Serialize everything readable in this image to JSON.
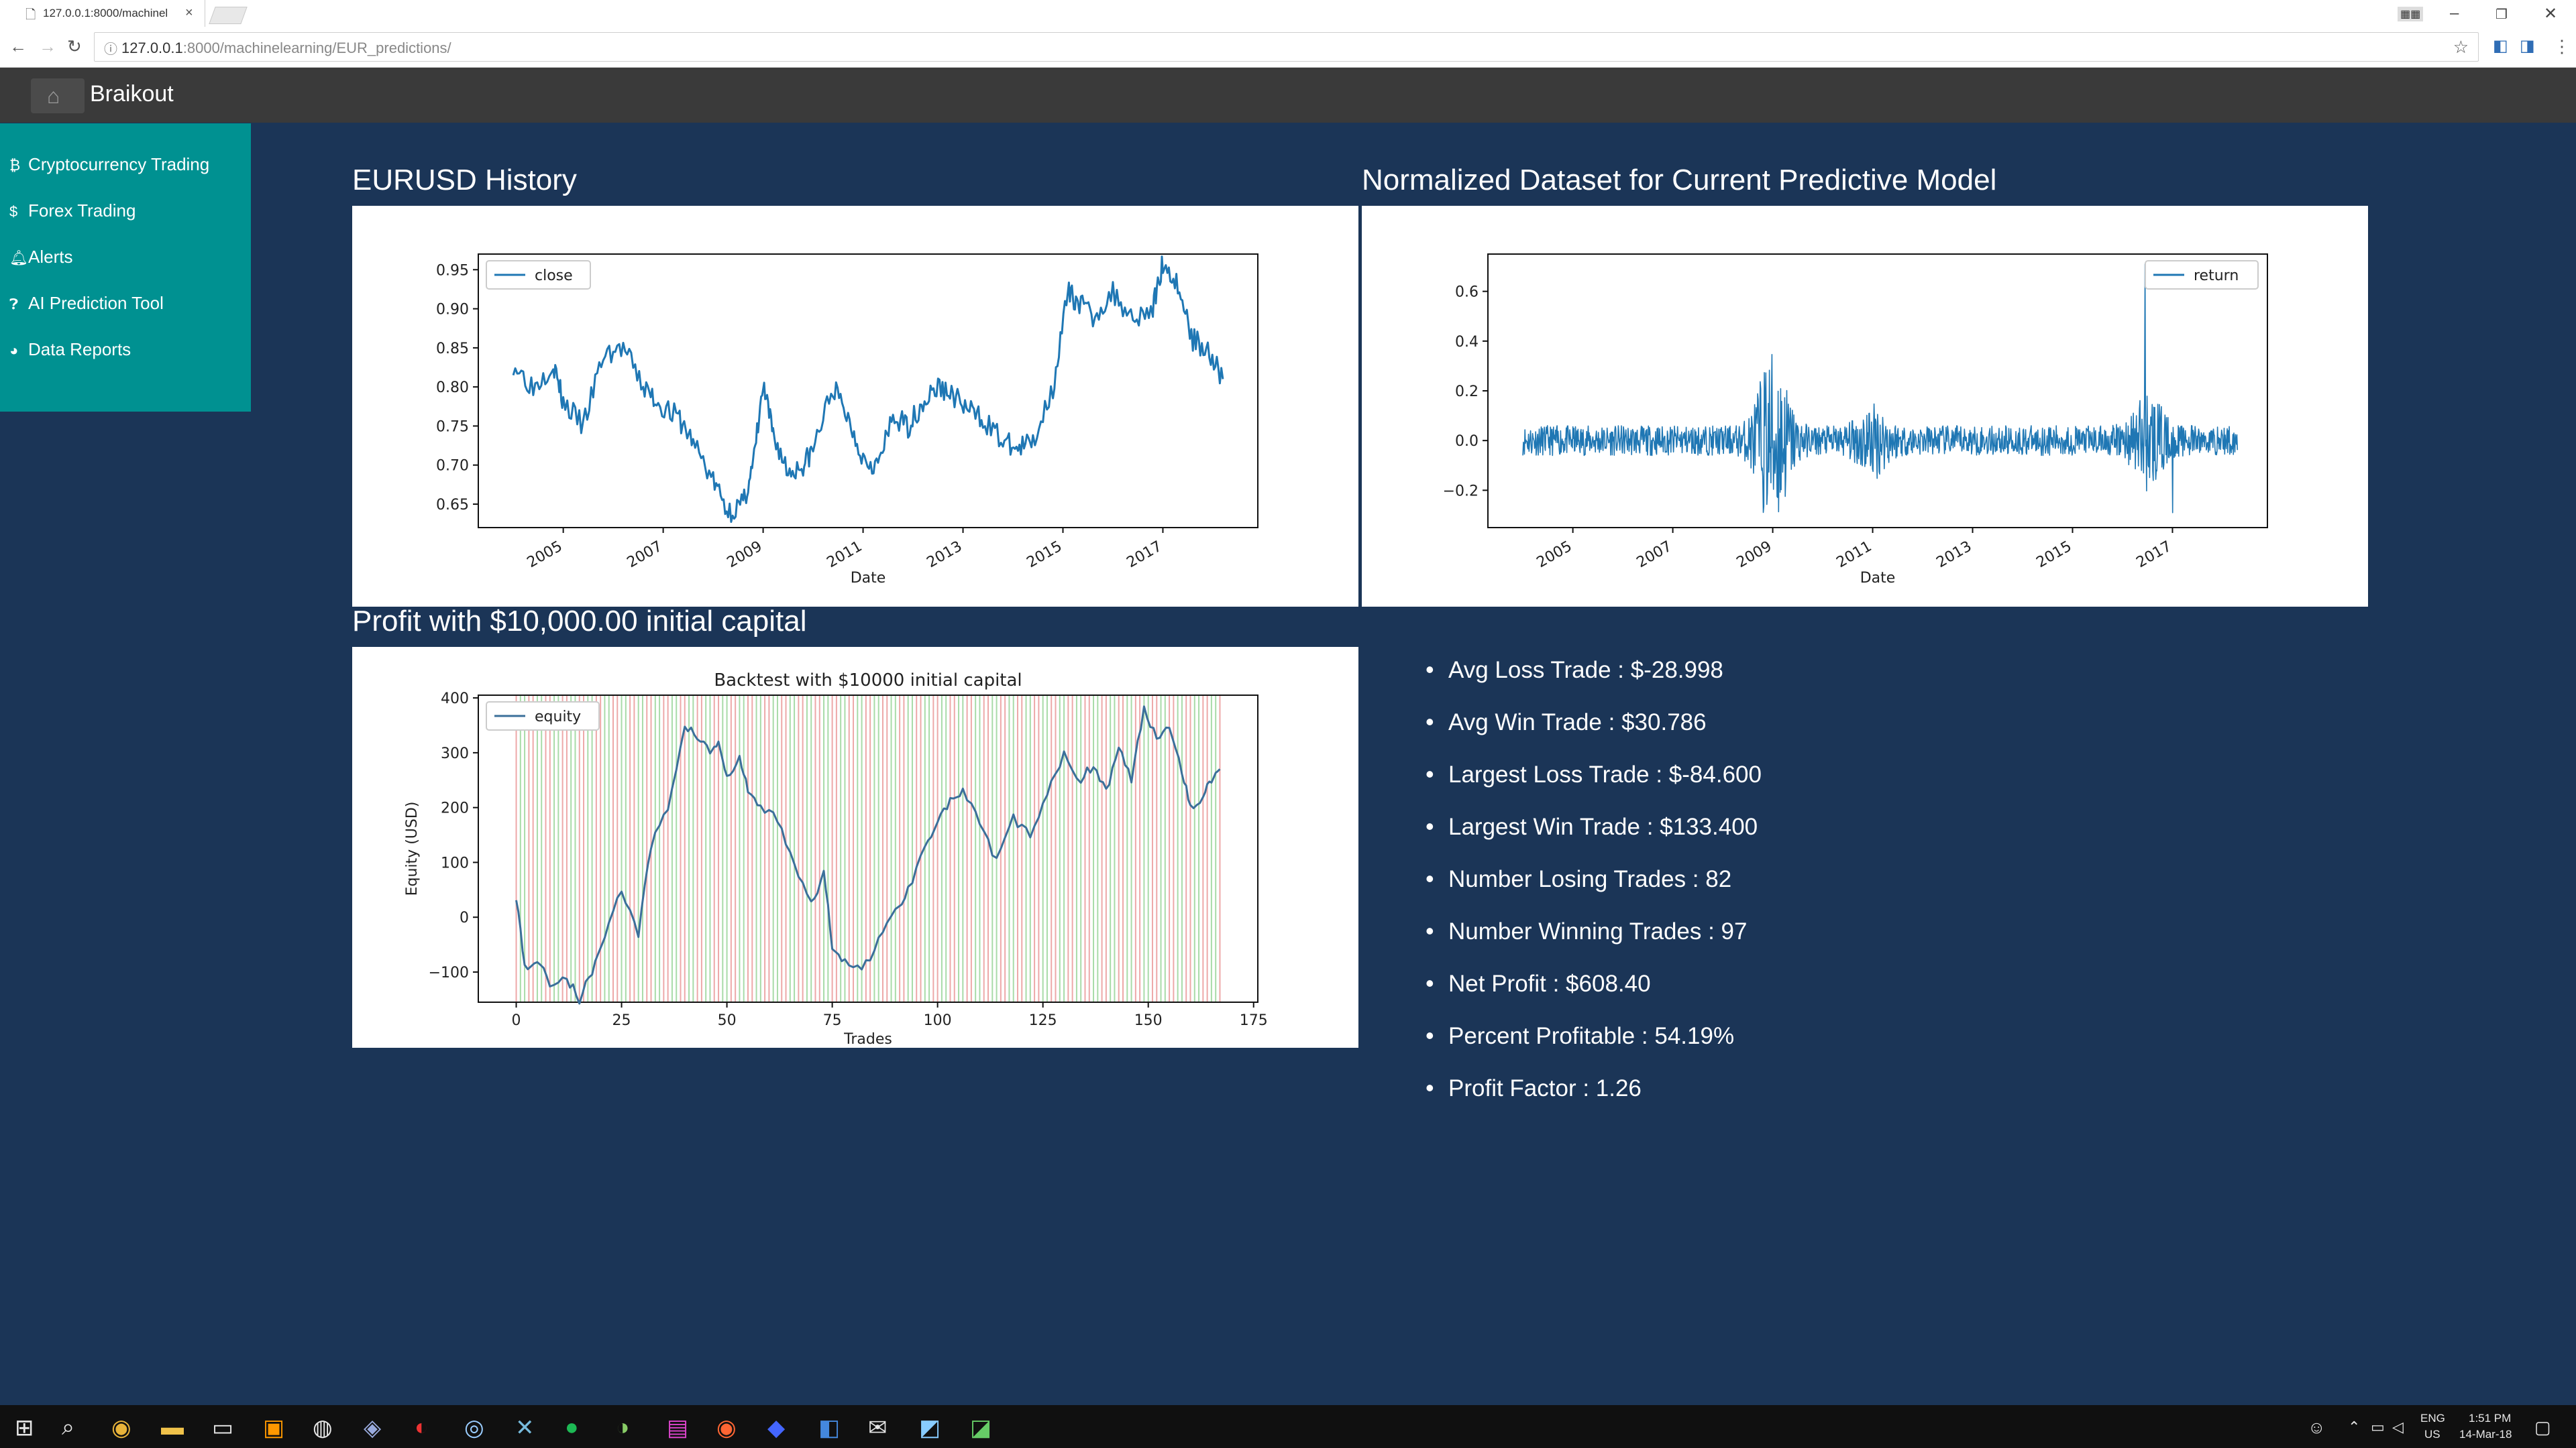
{
  "browser": {
    "tab_title": "127.0.0.1:8000/machinel",
    "url_host": "127.0.0.1",
    "url_rest": ":8000/machinelearning/EUR_predictions/"
  },
  "app": {
    "brand": "Braikout"
  },
  "sidebar": {
    "items": [
      {
        "label": "Cryptocurrency Trading",
        "icon": "bitcoin-icon"
      },
      {
        "label": "Forex Trading",
        "icon": "dollar-icon"
      },
      {
        "label": "Alerts",
        "icon": "bell-icon"
      },
      {
        "label": "AI Prediction Tool",
        "icon": "question-circle-icon"
      },
      {
        "label": "Data Reports",
        "icon": "pie-chart-icon"
      }
    ]
  },
  "sections": {
    "history_title": "EURUSD History",
    "normalized_title": "Normalized Dataset for Current Predictive Model",
    "profit_title": "Profit with $10,000.00 initial capital"
  },
  "stats": [
    "Avg Loss Trade : $-28.998",
    "Avg Win Trade : $30.786",
    "Largest Loss Trade : $-84.600",
    "Largest Win Trade : $133.400",
    "Number Losing Trades : 82",
    "Number Winning Trades : 97",
    "Net Profit : $608.40",
    "Percent Profitable : 54.19%",
    "Profit Factor : 1.26"
  ],
  "chart_data": [
    {
      "type": "line",
      "legend": [
        "close"
      ],
      "legend_position": "top-left",
      "xlabel": "Date",
      "ylabel": "",
      "xlim": [
        2003.3,
        2018.9
      ],
      "ylim": [
        0.62,
        0.97
      ],
      "x_ticks": [
        "2005",
        "2007",
        "2009",
        "2011",
        "2013",
        "2015",
        "2017"
      ],
      "y_ticks": [
        "0.65",
        "0.70",
        "0.75",
        "0.80",
        "0.85",
        "0.90",
        "0.95"
      ],
      "series": [
        {
          "name": "close",
          "color": "#1f77b4",
          "x": [
            2004.0,
            2004.4,
            2004.8,
            2005.0,
            2005.4,
            2005.8,
            2006.2,
            2006.6,
            2006.9,
            2007.3,
            2007.6,
            2008.0,
            2008.3,
            2008.6,
            2008.8,
            2009.0,
            2009.2,
            2009.5,
            2009.8,
            2010.0,
            2010.4,
            2010.7,
            2011.0,
            2011.3,
            2011.6,
            2011.9,
            2012.2,
            2012.5,
            2012.8,
            2013.1,
            2013.4,
            2013.8,
            2014.1,
            2014.4,
            2014.8,
            2015.1,
            2015.3,
            2015.6,
            2016.0,
            2016.4,
            2016.8,
            2017.0,
            2017.3,
            2017.6,
            2017.9,
            2018.2
          ],
          "y": [
            0.83,
            0.8,
            0.83,
            0.78,
            0.75,
            0.84,
            0.85,
            0.8,
            0.78,
            0.76,
            0.73,
            0.68,
            0.64,
            0.65,
            0.7,
            0.8,
            0.74,
            0.69,
            0.7,
            0.72,
            0.8,
            0.76,
            0.71,
            0.7,
            0.76,
            0.75,
            0.78,
            0.8,
            0.79,
            0.77,
            0.76,
            0.73,
            0.72,
            0.73,
            0.8,
            0.92,
            0.91,
            0.89,
            0.92,
            0.89,
            0.9,
            0.96,
            0.93,
            0.86,
            0.85,
            0.81
          ]
        }
      ]
    },
    {
      "type": "line",
      "legend": [
        "return"
      ],
      "legend_position": "top-right",
      "xlabel": "Date",
      "ylabel": "",
      "xlim": [
        2003.3,
        2018.9
      ],
      "ylim": [
        -0.35,
        0.75
      ],
      "x_ticks": [
        "2005",
        "2007",
        "2009",
        "2011",
        "2013",
        "2015",
        "2017"
      ],
      "y_ticks": [
        "−0.2",
        "0.0",
        "0.2",
        "0.4",
        "0.6"
      ],
      "series": [
        {
          "name": "return",
          "color": "#1f77b4",
          "noise_amplitude": 0.06,
          "volatility_peaks": [
            {
              "x": 2009.0,
              "amplitude": 0.32
            },
            {
              "x": 2011.0,
              "amplitude": 0.1
            },
            {
              "x": 2016.5,
              "amplitude": 0.15
            }
          ],
          "spikes": [
            {
              "x": 2016.45,
              "y": 0.71
            },
            {
              "x": 2017.0,
              "y": -0.29
            }
          ]
        }
      ]
    },
    {
      "type": "line",
      "title": "Backtest with $10000 initial capital",
      "legend": [
        "equity"
      ],
      "legend_position": "top-left",
      "xlabel": "Trades",
      "ylabel": "Equity (USD)",
      "xlim": [
        -9,
        176
      ],
      "ylim": [
        -155,
        405
      ],
      "x_ticks": [
        "0",
        "25",
        "50",
        "75",
        "100",
        "125",
        "150",
        "175"
      ],
      "y_ticks": [
        "−100",
        "0",
        "100",
        "200",
        "300",
        "400"
      ],
      "background_trade_lines": {
        "count": 168,
        "colors": [
          "#e88b8b",
          "#8bcf8b"
        ]
      },
      "series": [
        {
          "name": "equity",
          "color": "#3b6f9a",
          "x": [
            0,
            2,
            5,
            8,
            12,
            15,
            18,
            21,
            25,
            29,
            32,
            36,
            40,
            43,
            46,
            48,
            50,
            53,
            55,
            58,
            62,
            66,
            70,
            73,
            75,
            78,
            82,
            86,
            90,
            93,
            97,
            100,
            103,
            106,
            110,
            114,
            118,
            122,
            126,
            130,
            134,
            137,
            140,
            143,
            146,
            149,
            152,
            155,
            158,
            160,
            163,
            165,
            167
          ],
          "y": [
            40,
            -90,
            -80,
            -120,
            -110,
            -150,
            -100,
            -30,
            50,
            -30,
            130,
            200,
            350,
            330,
            300,
            320,
            250,
            290,
            230,
            200,
            180,
            100,
            20,
            80,
            -50,
            -80,
            -100,
            -40,
            10,
            50,
            130,
            180,
            210,
            230,
            170,
            100,
            180,
            150,
            220,
            300,
            250,
            280,
            230,
            310,
            250,
            380,
            330,
            350,
            270,
            200,
            220,
            250,
            270
          ]
        }
      ]
    }
  ],
  "taskbar": {
    "lang": "ENG",
    "region": "US",
    "time": "1:51 PM",
    "date": "14-Mar-18",
    "apps": [
      "windows-start-icon",
      "search-icon",
      "chrome-icon",
      "file-explorer-icon",
      "window-icon",
      "sublime-icon",
      "app-icon",
      "app-icon",
      "app-icon",
      "steam-icon",
      "app-icon",
      "spotify-icon",
      "app-icon",
      "app-icon",
      "app-icon",
      "app-icon",
      "app-icon",
      "mail-icon",
      "app-icon",
      "app-icon"
    ]
  }
}
